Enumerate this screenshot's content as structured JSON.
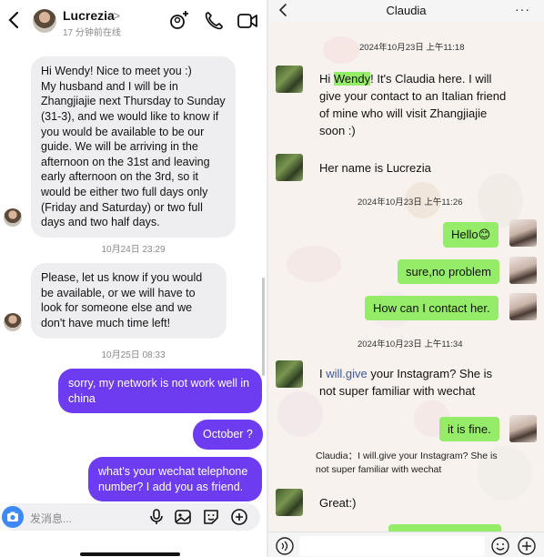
{
  "left": {
    "header": {
      "name": "Lucrezia",
      "chevron": ">",
      "status": "17 分钟前在线"
    },
    "messages": [
      {
        "text": "Hi Wendy! Nice to meet you :)\nMy husband and I will be in Zhangjiajie next Thursday to Sunday (31-3), and we would like to know if you would be available to be our guide. We will be arriving in the afternoon on the 31st and leaving early afternoon on the 3rd, so it would be either two full days only (Friday and Saturday) or two full days and two half days."
      },
      {
        "text": "Please, let us know if you would be available, or we will have to look for someone else and we don't have much time left!"
      },
      {
        "text": "sorry, my network is not work well in china"
      },
      {
        "text": "October ?"
      },
      {
        "text": "what's your wechat telephone number? I add you as friend."
      }
    ],
    "timestamps": [
      "10月24日 23:29",
      "10月25日 08:33"
    ],
    "input": {
      "placeholder": "发消息..."
    }
  },
  "right": {
    "header": {
      "title": "Claudia",
      "more": "···"
    },
    "timestamps": [
      "2024年10月23日 上午11:18",
      "2024年10月23日 上午11:26",
      "2024年10月23日 上午11:34"
    ],
    "messages": {
      "m1_pre": "Hi ",
      "m1_hl": "Wendy",
      "m1_post": "! It's Claudia here. I will give your contact to an Italian friend of mine who will visit Zhangjiajie soon :)",
      "m2": "Her name is Lucrezia",
      "m3": "Hello",
      "m3_emoji": "😊",
      "m4": "sure,no problem",
      "m5": "How can I contact her.",
      "m6_pre": "I ",
      "m6_link": "will.give",
      "m6_post": " your Instagram? She is not super familiar with wechat",
      "m7": "it is fine.",
      "quote": "Claudia：I will.give your Instagram? She is not super familiar with wechat",
      "m8": "Great:)"
    }
  },
  "colors": {
    "ig_out": "#6d3cf0",
    "ig_in": "#eeeef0",
    "wc_green": "#95ec69"
  }
}
